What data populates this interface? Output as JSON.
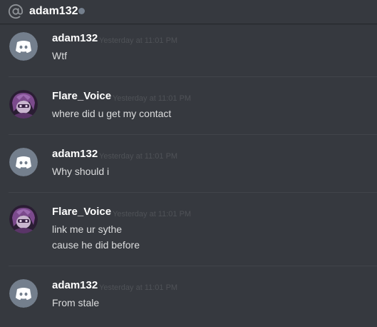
{
  "header": {
    "channel_name": "adam132",
    "status_color": "#747f8d"
  },
  "messages": [
    {
      "author": "adam132",
      "avatar": "discord-default-icon",
      "timestamp": "Yesterday at 11:01 PM",
      "lines": [
        "Wtf"
      ]
    },
    {
      "author": "Flare_Voice",
      "avatar": "purple-character-avatar",
      "timestamp": "Yesterday at 11:01 PM",
      "lines": [
        "where did u get my contact"
      ]
    },
    {
      "author": "adam132",
      "avatar": "discord-default-icon",
      "timestamp": "Yesterday at 11:01 PM",
      "lines": [
        "Why should i"
      ]
    },
    {
      "author": "Flare_Voice",
      "avatar": "purple-character-avatar",
      "timestamp": "Yesterday at 11:01 PM",
      "lines": [
        "link me ur sythe",
        "cause he did before"
      ]
    },
    {
      "author": "adam132",
      "avatar": "discord-default-icon",
      "timestamp": "Yesterday at 11:01 PM",
      "lines": [
        "From stale"
      ]
    }
  ],
  "colors": {
    "background": "#36393f",
    "author": "#ffffff",
    "text": "#dcddde",
    "timestamp": "#4f5257",
    "default_avatar": "#747f8d"
  }
}
